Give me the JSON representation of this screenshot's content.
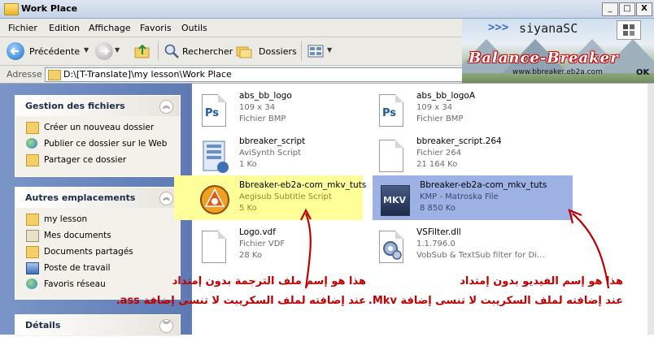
{
  "window": {
    "title": "Work Place",
    "controls": [
      "_",
      "□",
      "X"
    ]
  },
  "menu": [
    "Fichier",
    "Edition",
    "Affichage",
    "Favoris",
    "Outils"
  ],
  "toolbar": {
    "back": "Précédente",
    "search": "Rechercher",
    "folders": "Dossiers"
  },
  "address": {
    "label": "Adresse",
    "path": "D:\\[T-Translate]\\my lesson\\Work Place",
    "go": "OK"
  },
  "banner": {
    "arrows": ">>>",
    "title": "siyanaSC",
    "brand": "Balance-Breaker",
    "url": "www.bbreaker.eb2a.com"
  },
  "sidebar": {
    "tasks": {
      "title": "Gestion des fichiers",
      "items": [
        "Créer un nouveau dossier",
        "Publier ce dossier sur le Web",
        "Partager ce dossier"
      ]
    },
    "places": {
      "title": "Autres emplacements",
      "items": [
        "my lesson",
        "Mes documents",
        "Documents partagés",
        "Poste de travail",
        "Favoris réseau"
      ]
    },
    "details": {
      "title": "Détails"
    }
  },
  "files": [
    {
      "name": "abs_bb_logo",
      "line2": "109 x 34",
      "line3": "Fichier BMP",
      "icon": "photoshop-icon"
    },
    {
      "name": "abs_bb_logoA",
      "line2": "109 x 34",
      "line3": "Fichier BMP",
      "icon": "photoshop-icon"
    },
    {
      "name": "bbreaker_script",
      "line2": "AviSynth Script",
      "line3": "1 Ko",
      "icon": "avisynth-script-icon"
    },
    {
      "name": "bbreaker_script.264",
      "line2": "Fichier 264",
      "line3": "21 164 Ko",
      "icon": "generic-file-icon"
    },
    {
      "name": "Bbreaker-eb2a-com_mkv_tuts",
      "line2": "Aegisub Subtitle Script",
      "line3": "5 Ko",
      "icon": "aegisub-icon"
    },
    {
      "name": "Bbreaker-eb2a-com_mkv_tuts",
      "line2": "KMP - Matroska File",
      "line3": "8 850 Ko",
      "icon": "mkv-icon",
      "icon_text": "MKV"
    },
    {
      "name": "Logo.vdf",
      "line2": "Fichier VDF",
      "line3": "28 Ko",
      "icon": "generic-file-icon"
    },
    {
      "name": "VSFilter.dll",
      "line2": "1.1.796.0",
      "line3": "VobSub & TextSub filter for Di...",
      "icon": "dll-gear-icon"
    }
  ],
  "colors": {
    "highlight_ass": "#ffff99",
    "highlight_mkv": "#9db1e4",
    "annotation": "#c00000"
  },
  "annotations": {
    "ass": {
      "line1": "هذا هو إسم ملف الترجمة بدون إمتداد",
      "line2": "عند إضافته لملف السكريبت لا تنسى إضافة ass."
    },
    "mkv": {
      "line1": "هذا هو إسم الفيديو بدون إمتداد",
      "line2": "عند إضافته لملف السكريبت لا تنسى إضافة Mkv."
    }
  }
}
